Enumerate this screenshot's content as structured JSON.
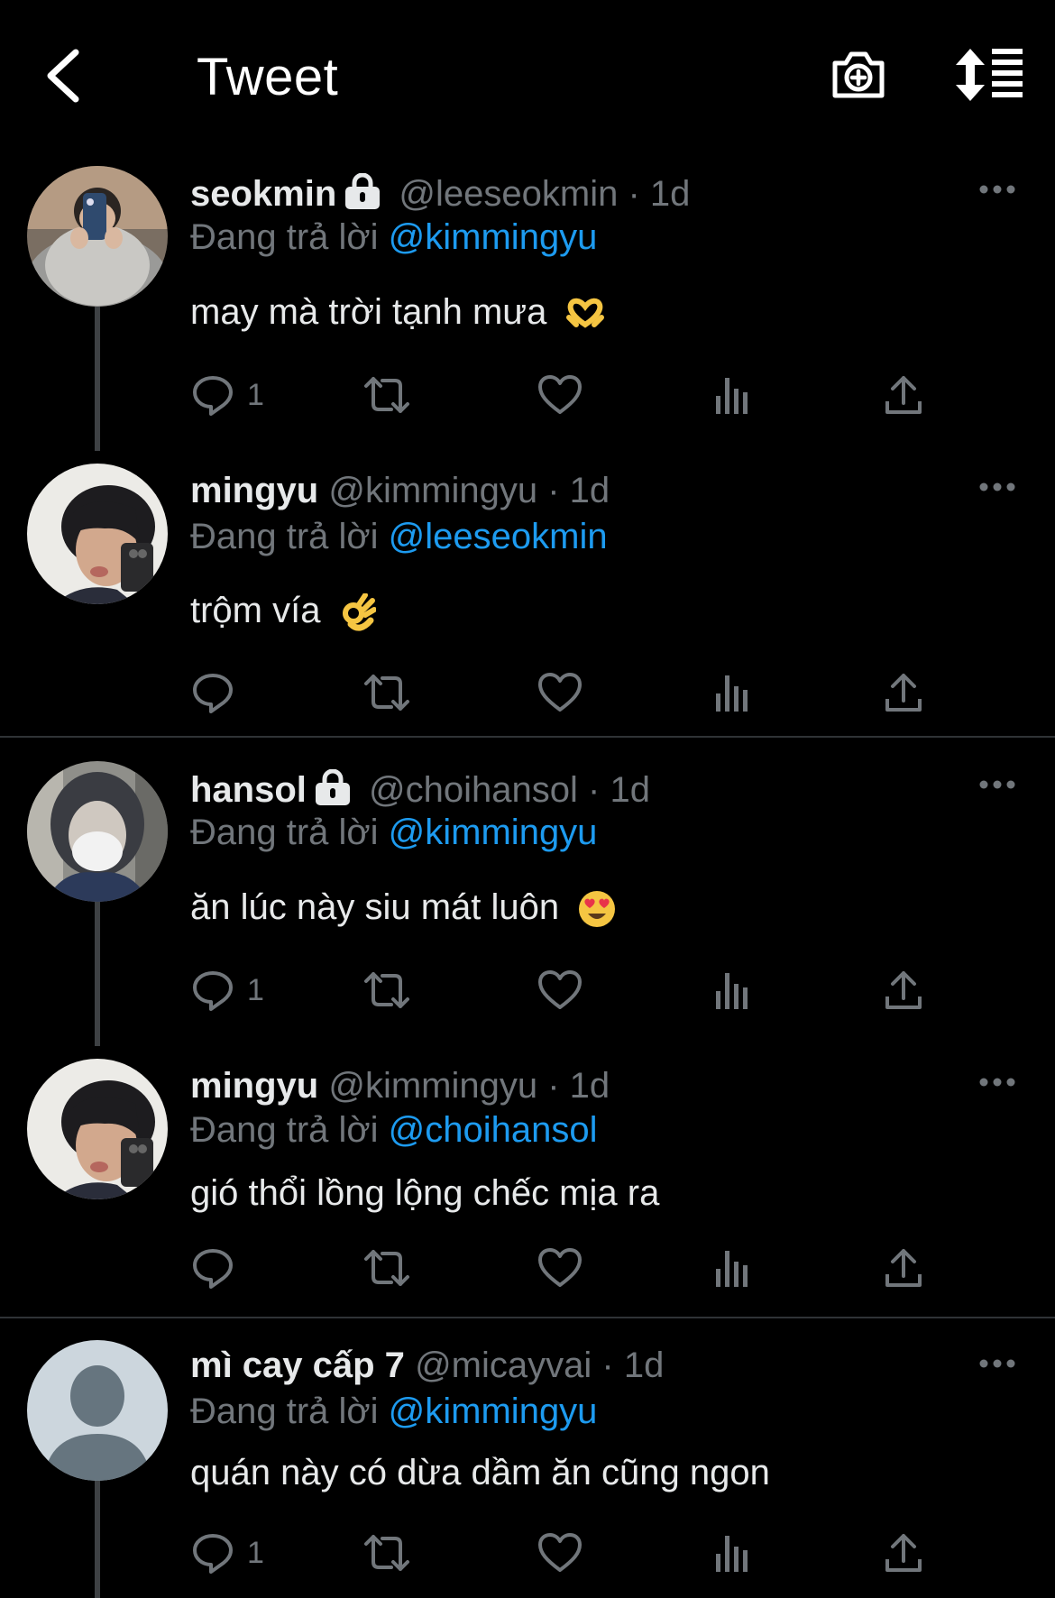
{
  "header": {
    "title": "Tweet"
  },
  "labels": {
    "replying_to": "Đang trả lời"
  },
  "icons": {
    "back": "chevron-left-icon",
    "camera": "camera-plus-icon",
    "sort": "sort-icon",
    "reply": "reply-icon",
    "retweet": "retweet-icon",
    "like": "heart-icon",
    "views": "views-icon",
    "share": "share-icon",
    "more": "more-icon",
    "lock": "lock-icon"
  },
  "colors": {
    "background": "#000000",
    "accent": "#1d9bf0",
    "muted": "#71767b",
    "text": "#e7e9ea"
  },
  "tweets": [
    {
      "name": "seokmin",
      "protected": true,
      "handle": "@leeseokmin",
      "time": "· 1d",
      "reply_to": "@kimmingyu",
      "text": "may mà trời tạnh mưa",
      "emoji": "heart-hands",
      "reply_count": "1"
    },
    {
      "name": "mingyu",
      "protected": false,
      "handle": "@kimmingyu",
      "time": "· 1d",
      "reply_to": "@leeseokmin",
      "text": "trộm vía",
      "emoji": "ok-hand",
      "reply_count": ""
    },
    {
      "name": "hansol",
      "protected": true,
      "handle": "@choihansol",
      "time": "· 1d",
      "reply_to": "@kimmingyu",
      "text": "ăn lúc này siu mát luôn",
      "emoji": "heart-eyes",
      "reply_count": "1"
    },
    {
      "name": "mingyu",
      "protected": false,
      "handle": "@kimmingyu",
      "time": "· 1d",
      "reply_to": "@choihansol",
      "text": "gió thổi lồng lộng chếc mịa ra",
      "emoji": "",
      "reply_count": ""
    },
    {
      "name": "mì cay cấp 7",
      "protected": false,
      "handle": "@micayvai",
      "time": "· 1d",
      "reply_to": "@kimmingyu",
      "text": "quán này có dừa dầm ăn cũng ngon",
      "emoji": "",
      "reply_count": "1"
    }
  ]
}
